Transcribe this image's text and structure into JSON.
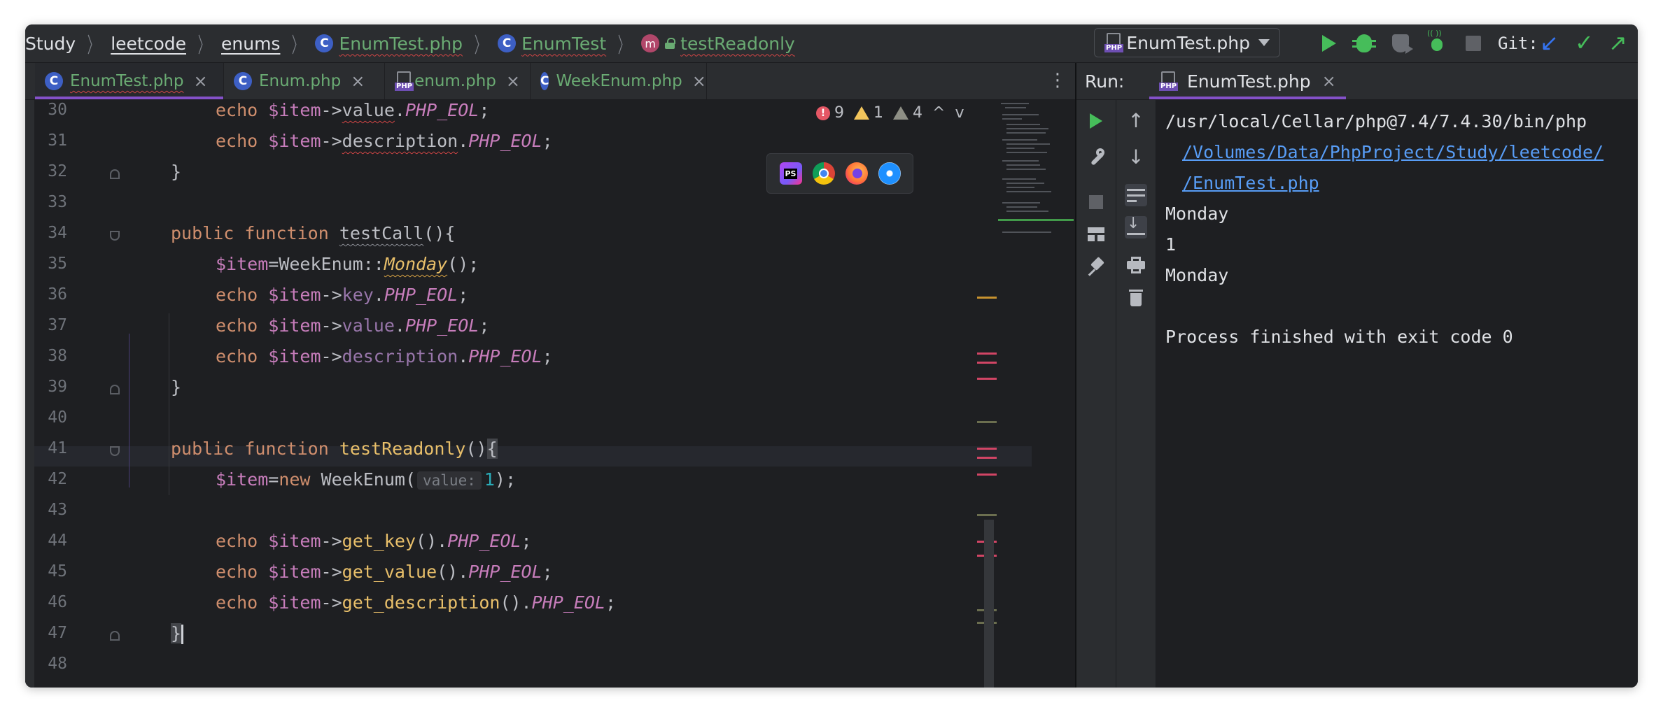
{
  "breadcrumb": {
    "items": [
      {
        "label": "Study",
        "icon": null
      },
      {
        "label": "leetcode",
        "icon": null
      },
      {
        "label": "enums",
        "icon": null
      },
      {
        "label": "EnumTest.php",
        "icon": "class-icon"
      },
      {
        "label": "EnumTest",
        "icon": "class-icon"
      },
      {
        "label": "testReadonly",
        "icon": "method-icon"
      }
    ],
    "class_icon_letter": "C",
    "method_icon_letter": "m"
  },
  "toolbar": {
    "run_config": "EnumTest.php",
    "php_tag": "PHP",
    "git_label": "Git:",
    "git_update_glyph": "↙",
    "git_commit_glyph": "✓",
    "git_push_glyph": "↗"
  },
  "editor_tabs": [
    {
      "label": "EnumTest.php",
      "icon": "class-icon",
      "active": true,
      "close": "×"
    },
    {
      "label": "Enum.php",
      "icon": "class-icon",
      "active": false,
      "close": "×"
    },
    {
      "label": "enum.php",
      "icon": "php-file-icon",
      "active": false,
      "close": "×"
    },
    {
      "label": "WeekEnum.php",
      "icon": "class-icon",
      "active": false,
      "close": "×"
    }
  ],
  "tab_more_glyph": "⋮",
  "inspections": {
    "errors": "9",
    "warnings": "1",
    "weak_warnings": "4",
    "up": "^",
    "down": "v"
  },
  "line_numbers": [
    "30",
    "31",
    "32",
    "33",
    "34",
    "35",
    "36",
    "37",
    "38",
    "39",
    "40",
    "41",
    "42",
    "43",
    "44",
    "45",
    "46",
    "47",
    "48"
  ],
  "code": {
    "echo": "echo",
    "item": "$item",
    "arrow": "->",
    "dot": ".",
    "semi": ";",
    "eol": "PHP_EOL",
    "value": "value",
    "description": "description",
    "key": "key",
    "close_brace": "}",
    "public": "public",
    "function": "function",
    "testCall": "testCall",
    "parens_open": "(){",
    "assign": "=",
    "weekenum_static": "WeekEnum::",
    "monday": "Monday",
    "call_end": "();",
    "testReadonly": "testReadonly",
    "parens": "()",
    "open_brace": "{",
    "new": "new",
    "weekenum": " WeekEnum(",
    "hint_value": "value:",
    "one": "1",
    "close_call": ");",
    "get_key": "get_key",
    "get_value": "get_value",
    "get_description": "get_description",
    "empty_parens": "()"
  },
  "run": {
    "title": "Run:",
    "tab_label": "EnumTest.php",
    "tab_close": "×",
    "output": {
      "cmd": "/usr/local/Cellar/php@7.4/7.4.30/bin/php",
      "link1": "/Volumes/Data/PhpProject/Study/leetcode/",
      "link2": "/EnumTest.php",
      "out1": "Monday",
      "out2": "1",
      "out3": "Monday",
      "finish": "Process finished with exit code 0"
    },
    "up_glyph": "↑",
    "down_glyph": "↓"
  },
  "browser_popup": {
    "phpstorm_label": "PS"
  },
  "colors": {
    "background": "#1e1f22",
    "panel": "#2b2d30",
    "keyword": "#cf8e6d",
    "variable": "#c77dbb",
    "accent": "#8451c9",
    "run_green": "#46bd5a",
    "link": "#589df6"
  }
}
